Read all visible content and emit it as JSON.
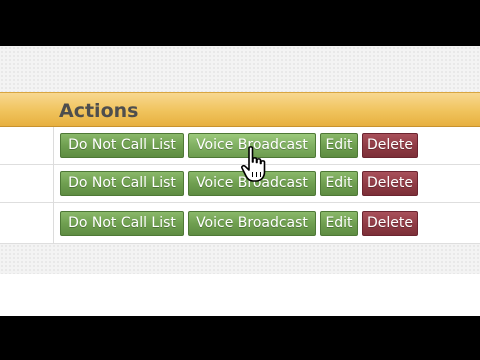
{
  "table": {
    "header": "Actions",
    "rows": [
      {
        "buttons": {
          "do_not_call": "Do Not Call List",
          "voice_broadcast": "Voice Broadcast",
          "edit": "Edit",
          "delete": "Delete"
        }
      },
      {
        "buttons": {
          "do_not_call": "Do Not Call List",
          "voice_broadcast": "Voice Broadcast",
          "edit": "Edit",
          "delete": "Delete"
        }
      },
      {
        "buttons": {
          "do_not_call": "Do Not Call List",
          "voice_broadcast": "Voice Broadcast",
          "edit": "Edit",
          "delete": "Delete"
        }
      }
    ]
  },
  "colors": {
    "header_bar": "#f0c35c",
    "green_button": "#6f9f50",
    "red_button": "#8e3a44"
  },
  "cursor": {
    "icon": "hand-pointer-icon"
  }
}
